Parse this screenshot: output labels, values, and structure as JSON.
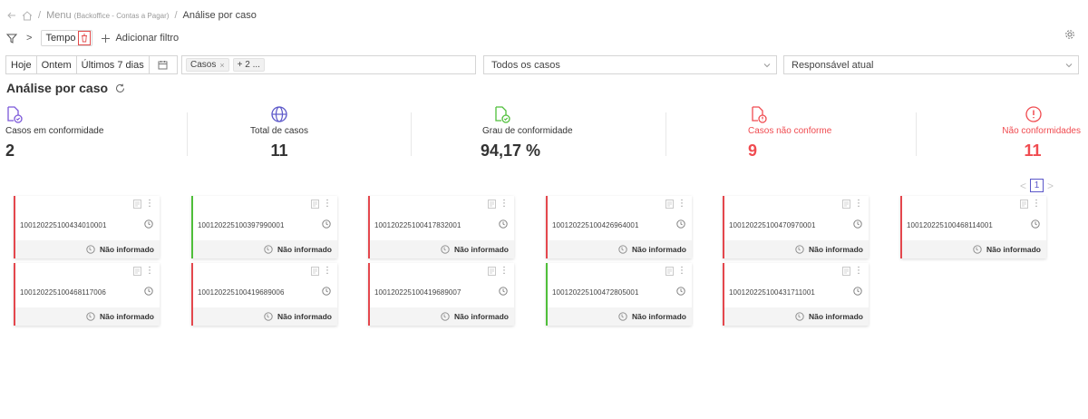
{
  "breadcrumb": {
    "menu": "Menu",
    "menu_context": "(Backoffice - Contas a Pagar)",
    "separator": "/",
    "current": "Análise por caso"
  },
  "filters": {
    "chevron": ">",
    "chip_label": "Tempo",
    "add_filter_label": "Adicionar filtro"
  },
  "date_options": [
    "Hoje",
    "Ontem",
    "Últimos 7 dias"
  ],
  "cases_select": {
    "tag_label": "Casos",
    "tag_remove": "×",
    "more_label": "+ 2 ..."
  },
  "status_dropdown": {
    "value": "Todos os casos"
  },
  "responsible_dropdown": {
    "value": "Responsável atual"
  },
  "page": {
    "title": "Análise por caso"
  },
  "metrics": [
    {
      "label": "Casos em conformidade",
      "value": "2",
      "icon": "doc-check-icon",
      "color": "#7b57d9"
    },
    {
      "label": "Total de casos",
      "value": "11",
      "icon": "globe-icon",
      "color": "#5b57c9"
    },
    {
      "label": "Grau de conformidade",
      "value": "94,17 %",
      "icon": "doc-check-icon",
      "color": "#4fbf3a"
    },
    {
      "label": "Casos não conforme",
      "value": "9",
      "icon": "doc-alert-icon",
      "color": "#f04b50"
    },
    {
      "label": "Não conformidades",
      "value": "11",
      "icon": "alert-circle-icon",
      "color": "#f04b50"
    }
  ],
  "pagination": {
    "current": "1",
    "prev": "<",
    "next": ">"
  },
  "card_status_text": "Não informado",
  "cards": [
    {
      "id": "10012022510043401000​1",
      "status": "red"
    },
    {
      "id": "100120225100397990001",
      "status": "green"
    },
    {
      "id": "100120225100417832001",
      "status": "red"
    },
    {
      "id": "100120225100426964001",
      "status": "red"
    },
    {
      "id": "100120225100470970001",
      "status": "red"
    },
    {
      "id": "100120225100468114001",
      "status": "red"
    },
    {
      "id": "100120225100468117006",
      "status": "red"
    },
    {
      "id": "100120225100419689006",
      "status": "red"
    },
    {
      "id": "100120225100419689007",
      "status": "red"
    },
    {
      "id": "100120225100472805001",
      "status": "green"
    },
    {
      "id": "100120225100431711001",
      "status": "red"
    }
  ],
  "colors": {
    "accent": "#5b57c9",
    "danger": "#f04b50",
    "success": "#4fbf3a",
    "card_red": "#e4474d"
  }
}
